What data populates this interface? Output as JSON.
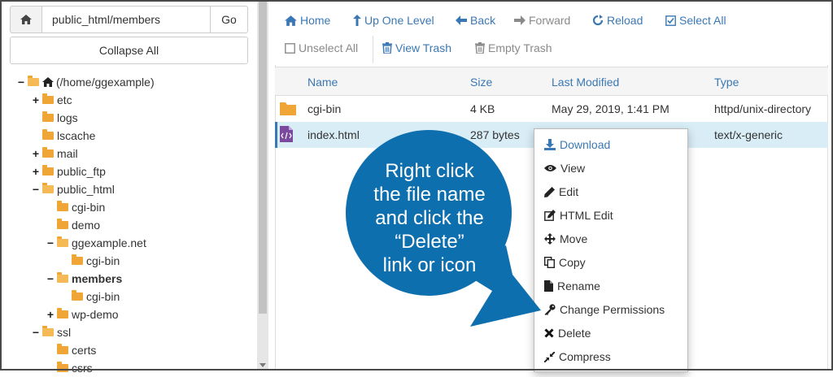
{
  "path_bar": {
    "value": "public_html/members",
    "go_label": "Go"
  },
  "collapse_label": "Collapse All",
  "tree": [
    {
      "label": "(/home/ggexample)",
      "toggle": "−",
      "home": true
    },
    {
      "label": "etc",
      "toggle": "+"
    },
    {
      "label": "logs",
      "toggle": ""
    },
    {
      "label": "lscache",
      "toggle": ""
    },
    {
      "label": "mail",
      "toggle": "+"
    },
    {
      "label": "public_ftp",
      "toggle": "+"
    },
    {
      "label": "public_html",
      "toggle": "−"
    },
    {
      "label": "cgi-bin",
      "toggle": ""
    },
    {
      "label": "demo",
      "toggle": ""
    },
    {
      "label": "ggexample.net",
      "toggle": "−"
    },
    {
      "label": "cgi-bin",
      "toggle": ""
    },
    {
      "label": "members",
      "toggle": "−",
      "bold": true
    },
    {
      "label": "cgi-bin",
      "toggle": ""
    },
    {
      "label": "wp-demo",
      "toggle": "+"
    },
    {
      "label": "ssl",
      "toggle": "−"
    },
    {
      "label": "certs",
      "toggle": ""
    },
    {
      "label": "csrs",
      "toggle": ""
    }
  ],
  "toolbar": {
    "home": "Home",
    "up_one_level": "Up One Level",
    "back": "Back",
    "forward": "Forward",
    "reload": "Reload",
    "select_all": "Select All",
    "unselect_all": "Unselect All",
    "view_trash": "View Trash",
    "empty_trash": "Empty Trash"
  },
  "table": {
    "headers": {
      "name": "Name",
      "size": "Size",
      "modified": "Last Modified",
      "type": "Type"
    },
    "rows": [
      {
        "name": "cgi-bin",
        "size": "4 KB",
        "modified": "May 29, 2019, 1:41 PM",
        "type": "httpd/unix-directory"
      },
      {
        "name": "index.html",
        "size": "287 bytes",
        "modified": "",
        "type": "text/x-generic"
      }
    ]
  },
  "context_menu": {
    "download": "Download",
    "view": "View",
    "edit": "Edit",
    "html_edit": "HTML Edit",
    "move": "Move",
    "copy": "Copy",
    "rename": "Rename",
    "change_permissions": "Change Permissions",
    "delete": "Delete",
    "compress": "Compress"
  },
  "callout": {
    "lines": [
      "Right click",
      "the file name",
      "and click the",
      "“Delete”",
      "link or icon"
    ]
  },
  "colors": {
    "link": "#3a78b5",
    "selected_row": "#d9edf7",
    "callout": "#0e6fae",
    "folder": "#f0a637"
  }
}
